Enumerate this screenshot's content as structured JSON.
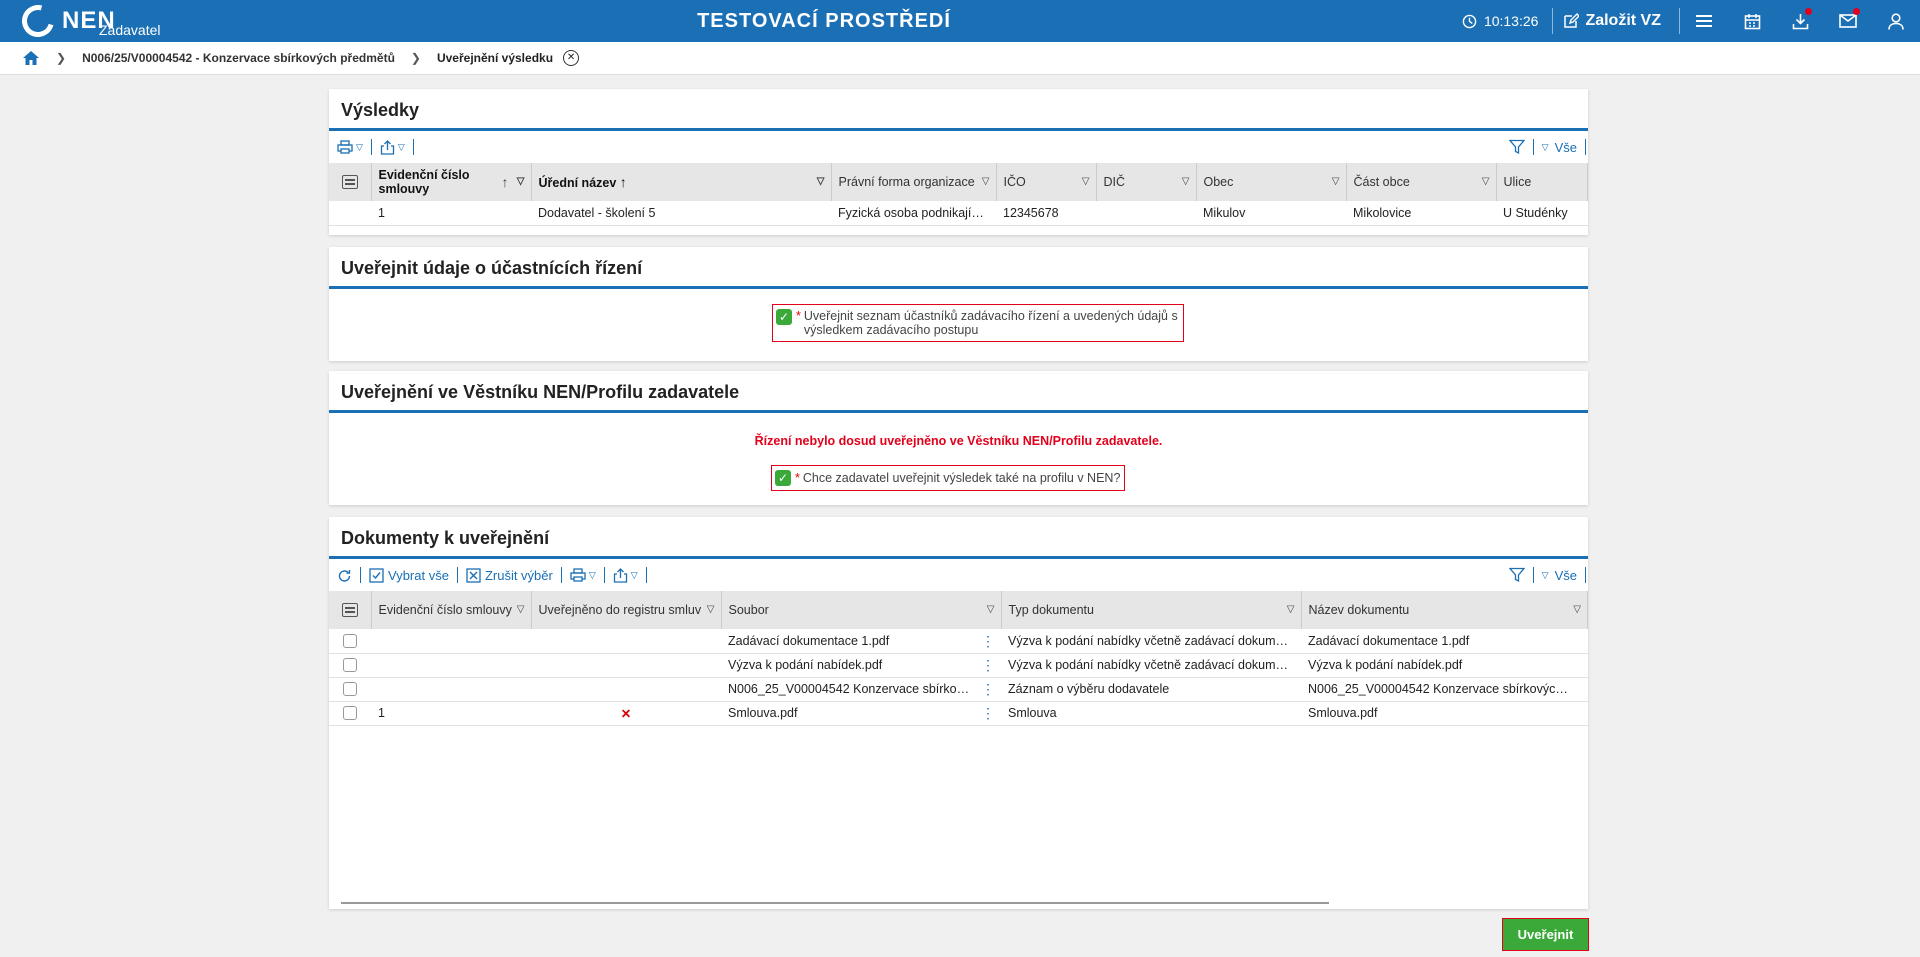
{
  "header": {
    "logo_text": "NEN",
    "logo_sub": "Zadavatel",
    "env_title": "TESTOVACÍ PROSTŘEDÍ",
    "clock": "10:13:26",
    "create_label": "Založit VZ"
  },
  "breadcrumb": {
    "item1": "N006/25/V00004542 - Konzervace sbírkových předmětů",
    "current": "Uveřejnění výsledku"
  },
  "results": {
    "title": "Výsledky",
    "filter_all": "Vše",
    "columns": [
      "Evidenční číslo smlouvy",
      "Úřední název",
      "Právní forma organizace",
      "IČO",
      "DIČ",
      "Obec",
      "Část obce",
      "Ulice"
    ],
    "row": {
      "c0": "1",
      "c1": "Dodavatel - školení 5",
      "c2": "Fyzická osoba podnikají…",
      "c3": "12345678",
      "c4": "",
      "c5": "Mikulov",
      "c6": "Mikolovice",
      "c7": "U Studénky"
    }
  },
  "participants": {
    "title": "Uveřejnit údaje o účastnících řízení",
    "checkbox_label": "Uveřejnit seznam účastníků zadávacího řízení a uvedených údajů s výsledkem zadávacího postupu",
    "required_mark": "*"
  },
  "bulletin": {
    "title": "Uveřejnění ve Věstníku NEN/Profilu zadavatele",
    "warning": "Řízení nebylo dosud uveřejněno ve Věstníku NEN/Profilu zadavatele.",
    "checkbox_label": "Chce zadavatel uveřejnit výsledek také na profilu v NEN?",
    "required_mark": "*"
  },
  "documents": {
    "title": "Dokumenty k uveřejnění",
    "select_all": "Vybrat vše",
    "cancel_selection": "Zrušit výběr",
    "filter_all": "Vše",
    "columns": [
      "Evidenční číslo smlouvy",
      "Uveřejněno do registru smluv",
      "Soubor",
      "Typ dokumentu",
      "Název dokumentu"
    ],
    "rows": [
      {
        "evid": "",
        "registr": "",
        "soubor": "Zadávací dokumentace 1.pdf",
        "typ": "Výzva k podání nabídky včetně zadávací dokum…",
        "nazev": "Zadávací dokumentace 1.pdf"
      },
      {
        "evid": "",
        "registr": "",
        "soubor": "Výzva k podání nabídek.pdf",
        "typ": "Výzva k podání nabídky včetně zadávací dokum…",
        "nazev": "Výzva k podání nabídek.pdf"
      },
      {
        "evid": "",
        "registr": "",
        "soubor": "N006_25_V00004542 Konzervace sbírko…",
        "typ": "Záznam o výběru dodavatele",
        "nazev": "N006_25_V00004542 Konzervace sbírkovýc…"
      },
      {
        "evid": "1",
        "registr": "✕",
        "soubor": "Smlouva.pdf",
        "typ": "Smlouva",
        "nazev": "Smlouva.pdf"
      }
    ]
  },
  "actions": {
    "publish": "Uveřejnit"
  }
}
